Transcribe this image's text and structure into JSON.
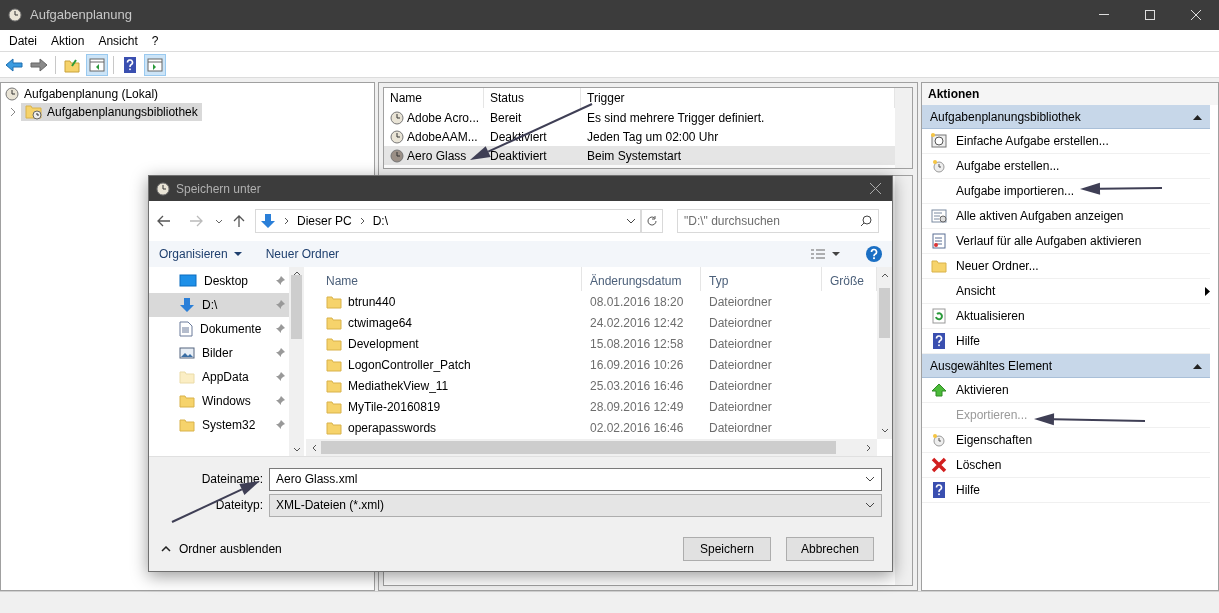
{
  "window": {
    "title": "Aufgabenplanung"
  },
  "menu": [
    "Datei",
    "Aktion",
    "Ansicht",
    "?"
  ],
  "toolbar": [
    {
      "kind": "back",
      "pressed": false
    },
    {
      "kind": "forward",
      "pressed": false
    },
    {
      "kind": "sep"
    },
    {
      "kind": "folder-up",
      "pressed": false
    },
    {
      "kind": "pane-left",
      "pressed": true
    },
    {
      "kind": "sep"
    },
    {
      "kind": "help",
      "pressed": false
    },
    {
      "kind": "pane-right",
      "pressed": true
    }
  ],
  "tree": [
    {
      "label": "Aufgabenplanung (Lokal)",
      "kind": "clock",
      "selected": false,
      "children": [
        {
          "label": "Aufgabenplanungsbibliothek",
          "kind": "folder-clock",
          "selected": true
        }
      ]
    }
  ],
  "task_table": {
    "columns": [
      "Name",
      "Status",
      "Trigger"
    ],
    "rows": [
      {
        "name": "Adobe Acro...",
        "status": "Bereit",
        "trigger": "Es sind mehrere Trigger definiert.",
        "selected": false
      },
      {
        "name": "AdobeAAM...",
        "status": "Deaktiviert",
        "trigger": "Jeden Tag um 02:00 Uhr",
        "selected": false
      },
      {
        "name": "Aero Glass",
        "status": "Deaktiviert",
        "trigger": "Beim Systemstart",
        "selected": true
      }
    ]
  },
  "actions": {
    "title": "Aktionen",
    "sections": [
      {
        "title": "Aufgabenplanungsbibliothek",
        "expanded": true,
        "items": [
          {
            "label": "Einfache Aufgabe erstellen...",
            "kind": "wizard",
            "disabled": false,
            "submenu": false
          },
          {
            "label": "Aufgabe erstellen...",
            "kind": "task",
            "disabled": false,
            "submenu": false
          },
          {
            "label": "Aufgabe importieren...",
            "kind": "plain",
            "disabled": false,
            "submenu": false
          },
          {
            "label": "Alle aktiven Aufgaben anzeigen",
            "kind": "list",
            "disabled": false,
            "submenu": false
          },
          {
            "label": "Verlauf für alle Aufgaben aktivieren",
            "kind": "log",
            "disabled": false,
            "submenu": false
          },
          {
            "label": "Neuer Ordner...",
            "kind": "folder",
            "disabled": false,
            "submenu": false
          },
          {
            "label": "Ansicht",
            "kind": "plain",
            "disabled": false,
            "submenu": true
          },
          {
            "label": "Aktualisieren",
            "kind": "refresh",
            "disabled": false,
            "submenu": false
          },
          {
            "label": "Hilfe",
            "kind": "help",
            "disabled": false,
            "submenu": false
          }
        ]
      },
      {
        "title": "Ausgewähltes Element",
        "expanded": true,
        "items": [
          {
            "label": "Aktivieren",
            "kind": "up",
            "disabled": false,
            "submenu": false
          },
          {
            "label": "Exportieren...",
            "kind": "plain",
            "disabled": true,
            "submenu": false
          },
          {
            "label": "Eigenschaften",
            "kind": "task",
            "disabled": false,
            "submenu": false
          },
          {
            "label": "Löschen",
            "kind": "delete",
            "disabled": false,
            "submenu": false
          },
          {
            "label": "Hilfe",
            "kind": "help",
            "disabled": false,
            "submenu": false
          }
        ]
      }
    ]
  },
  "dialog": {
    "title": "Speichern unter",
    "breadcrumb": [
      "Dieser PC",
      "D:\\"
    ],
    "search": {
      "placeholder": "\"D:\\\" durchsuchen"
    },
    "toolbar": [
      "Organisieren",
      "Neuer Ordner"
    ],
    "nav": [
      {
        "label": "Desktop",
        "kind": "desktop",
        "selected": false
      },
      {
        "label": "D:\\",
        "kind": "download",
        "selected": true
      },
      {
        "label": "Dokumente",
        "kind": "document",
        "selected": false
      },
      {
        "label": "Bilder",
        "kind": "pictures",
        "selected": false
      },
      {
        "label": "AppData",
        "kind": "folder-pale",
        "selected": false
      },
      {
        "label": "Windows",
        "kind": "folder",
        "selected": false
      },
      {
        "label": "System32",
        "kind": "folder",
        "selected": false
      }
    ],
    "columns": [
      "Name",
      "Änderungsdatum",
      "Typ",
      "Größe"
    ],
    "files": [
      {
        "name": "btrun440",
        "date": "08.01.2016 18:20",
        "type": "Dateiordner"
      },
      {
        "name": "ctwimage64",
        "date": "24.02.2016 12:42",
        "type": "Dateiordner"
      },
      {
        "name": "Development",
        "date": "15.08.2016 12:58",
        "type": "Dateiordner"
      },
      {
        "name": "LogonController_Patch",
        "date": "16.09.2016 10:26",
        "type": "Dateiordner"
      },
      {
        "name": "MediathekView_11",
        "date": "25.03.2016 16:46",
        "type": "Dateiordner"
      },
      {
        "name": "MyTile-20160819",
        "date": "28.09.2016 12:49",
        "type": "Dateiordner"
      },
      {
        "name": "operapasswords",
        "date": "02.02.2016 16:46",
        "type": "Dateiordner"
      }
    ],
    "filename": {
      "label": "Dateiname:",
      "value": "Aero Glass.xml"
    },
    "filetype": {
      "label": "Dateityp:",
      "value": "XML-Dateien (*.xml)"
    },
    "hide_folders": "Ordner ausblenden",
    "buttons": [
      "Speichern",
      "Abbrechen"
    ]
  }
}
